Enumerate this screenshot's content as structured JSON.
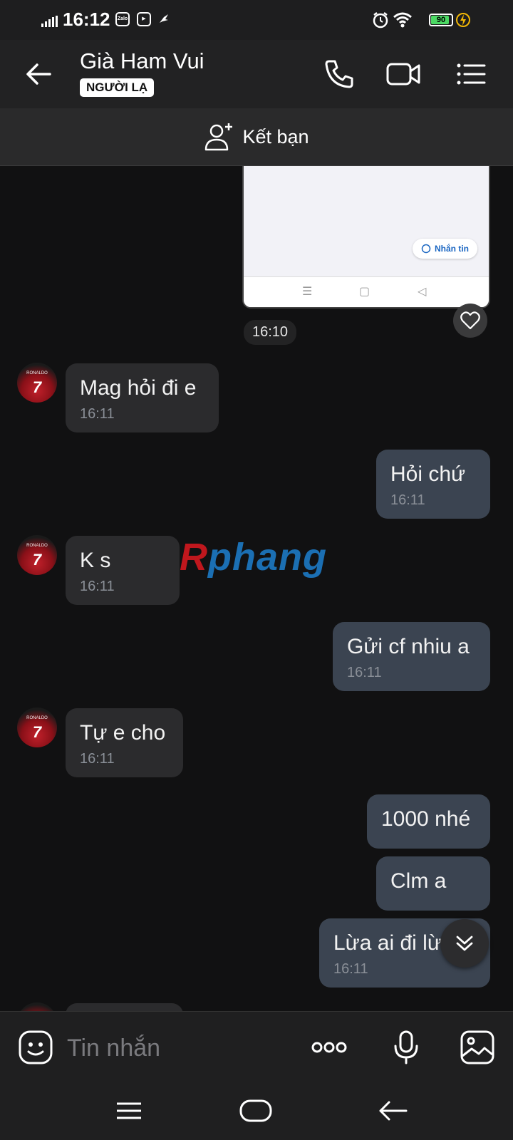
{
  "status_bar": {
    "time": "16:12",
    "app_icons": [
      "zalo-icon",
      "youtube-icon",
      "bird-icon"
    ],
    "battery": "90",
    "battery_level": 0.9
  },
  "header": {
    "name": "Già Ham Vui",
    "badge": "NGƯỜI LẠ"
  },
  "friend_bar": {
    "label": "Kết bạn"
  },
  "shared_image": {
    "button_label": "Nhắn tin",
    "time": "16:10"
  },
  "avatar_text": {
    "name": "RONALDO",
    "number": "7"
  },
  "messages": [
    {
      "direction": "in",
      "text": "Mag hỏi đi e",
      "time": "16:11"
    },
    {
      "direction": "out",
      "text": "Hỏi chứ",
      "time": "16:11"
    },
    {
      "direction": "in",
      "text": "K s",
      "time": "16:11"
    },
    {
      "direction": "out",
      "text": "Gửi cf nhiu a",
      "time": "16:11"
    },
    {
      "direction": "in",
      "text": "Tự e cho",
      "time": "16:11"
    },
    {
      "direction": "out",
      "text": "1000 nhé",
      "time": ""
    },
    {
      "direction": "out",
      "text": "Clm a",
      "time": ""
    },
    {
      "direction": "out",
      "text": "Lừa ai đi lừ",
      "time": "16:11"
    }
  ],
  "watermark": {
    "first": "R",
    "rest": "phang"
  },
  "input": {
    "placeholder": "Tin nhắn"
  },
  "colors": {
    "background": "#111112",
    "bubble_in": "#2b2b2d",
    "bubble_out": "#3b4451",
    "header": "#222223",
    "battery_fill": "#4cd964"
  }
}
